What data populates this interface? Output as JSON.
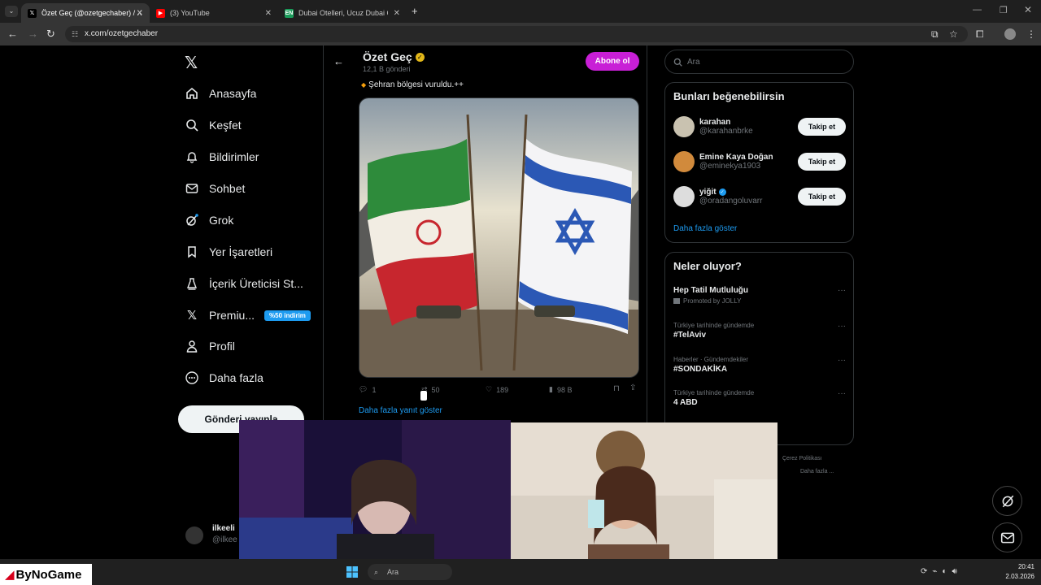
{
  "browser": {
    "tabs": [
      {
        "title": "Özet Geç (@ozetgechaber) / X",
        "favicon": "x-logo",
        "active": true
      },
      {
        "title": "(3) YouTube",
        "favicon": "youtube-logo",
        "active": false
      },
      {
        "title": "Dubai Otelleri, Ucuz Dubai Otelleri",
        "favicon": "site-logo",
        "active": false
      }
    ],
    "url": "x.com/ozetgechaber"
  },
  "sidebar": {
    "items": [
      {
        "label": "Anasayfa",
        "icon": "home-icon"
      },
      {
        "label": "Keşfet",
        "icon": "search-icon"
      },
      {
        "label": "Bildirimler",
        "icon": "bell-icon"
      },
      {
        "label": "Sohbet",
        "icon": "mail-icon"
      },
      {
        "label": "Grok",
        "icon": "grok-icon"
      },
      {
        "label": "Yer İşaretleri",
        "icon": "bookmark-icon"
      },
      {
        "label": "İçerik Üreticisi St...",
        "icon": "creator-icon"
      },
      {
        "label": "Premiu...",
        "icon": "x-icon",
        "badge": "%50 indirim"
      },
      {
        "label": "Profil",
        "icon": "person-icon"
      },
      {
        "label": "Daha fazla",
        "icon": "more-icon"
      }
    ],
    "post_button": "Gönderi yayınla",
    "account": {
      "name": "ilkeeli",
      "handle": "@ilkee"
    }
  },
  "profile_header": {
    "name": "Özet Geç",
    "post_count": "12,1 B gönderi",
    "subscribe_label": "Abone ol"
  },
  "post": {
    "text": "Şehran bölgesi vuruldu.++",
    "actions": {
      "replies": "1",
      "reposts": "50",
      "likes": "189",
      "views": "98 B"
    },
    "show_more": "Daha fazla yanıt göster"
  },
  "search": {
    "placeholder": "Ara"
  },
  "suggestions": {
    "title": "Bunları beğenebilirsin",
    "users": [
      {
        "name": "karahan",
        "handle": "@karahanbrke",
        "verified": false
      },
      {
        "name": "Emine Kaya Doğan",
        "handle": "@eminekya1903",
        "verified": false
      },
      {
        "name": "yiğit",
        "handle": "@oradangoluvarr",
        "verified": true
      }
    ],
    "follow_label": "Takip et",
    "show_more": "Daha fazla göster"
  },
  "trends": {
    "title": "Neler oluyor?",
    "items": [
      {
        "meta": "",
        "name": "Hep Tatil Mutluluğu",
        "sub": "Promoted by JOLLY"
      },
      {
        "meta": "Türkiye tarihinde gündemde",
        "name": "#TelAviv",
        "sub": ""
      },
      {
        "meta": "Haberler · Gündemdekiler",
        "name": "#SONDAKİKA",
        "sub": ""
      },
      {
        "meta": "Türkiye tarihinde gündemde",
        "name": "4 ABD",
        "sub": ""
      }
    ]
  },
  "footer_links": {
    "a": "Çerez Politikası",
    "b": "Daha fazla ..."
  },
  "taskbar": {
    "search": "Ara",
    "time": "20:41",
    "date": "2.03.2026"
  },
  "overlay_logo": "ByNoGame",
  "colors": {
    "accent": "#1d9bf0",
    "subscribe": "#c81fd6",
    "verified_gold": "#e2b719"
  }
}
